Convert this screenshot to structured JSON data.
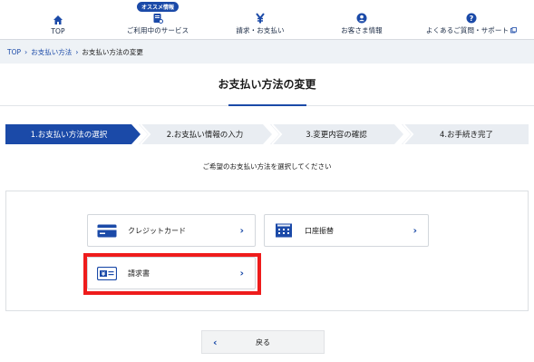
{
  "nav": {
    "items": [
      {
        "label": "TOP",
        "icon": "home-icon"
      },
      {
        "label": "ご利用中のサービス",
        "icon": "services-icon",
        "badge": "オススメ情報"
      },
      {
        "label": "請求・お支払い",
        "icon": "yen-icon"
      },
      {
        "label": "お客さま情報",
        "icon": "user-icon"
      },
      {
        "label": "よくあるご質問・サポート",
        "icon": "question-icon"
      }
    ]
  },
  "breadcrumb": {
    "items": [
      "TOP",
      "お支払い方法"
    ],
    "current": "お支払い方法の変更"
  },
  "page": {
    "title": "お支払い方法の変更",
    "instruction": "ご希望のお支払い方法を選択してください",
    "back_label": "戻る"
  },
  "steps": [
    {
      "label": "1.お支払い方法の選択",
      "active": true
    },
    {
      "label": "2.お支払い情報の入力",
      "active": false
    },
    {
      "label": "3.変更内容の確認",
      "active": false
    },
    {
      "label": "4.お手続き完了",
      "active": false
    }
  ],
  "options": [
    {
      "label": "クレジットカード",
      "icon": "credit-card-icon"
    },
    {
      "label": "口座振替",
      "icon": "bank-icon"
    },
    {
      "label": "請求書",
      "icon": "invoice-icon"
    }
  ],
  "colors": {
    "accent": "#1b4aa8",
    "step_inactive": "#e9edf2",
    "highlight": "#ee1c1c"
  }
}
